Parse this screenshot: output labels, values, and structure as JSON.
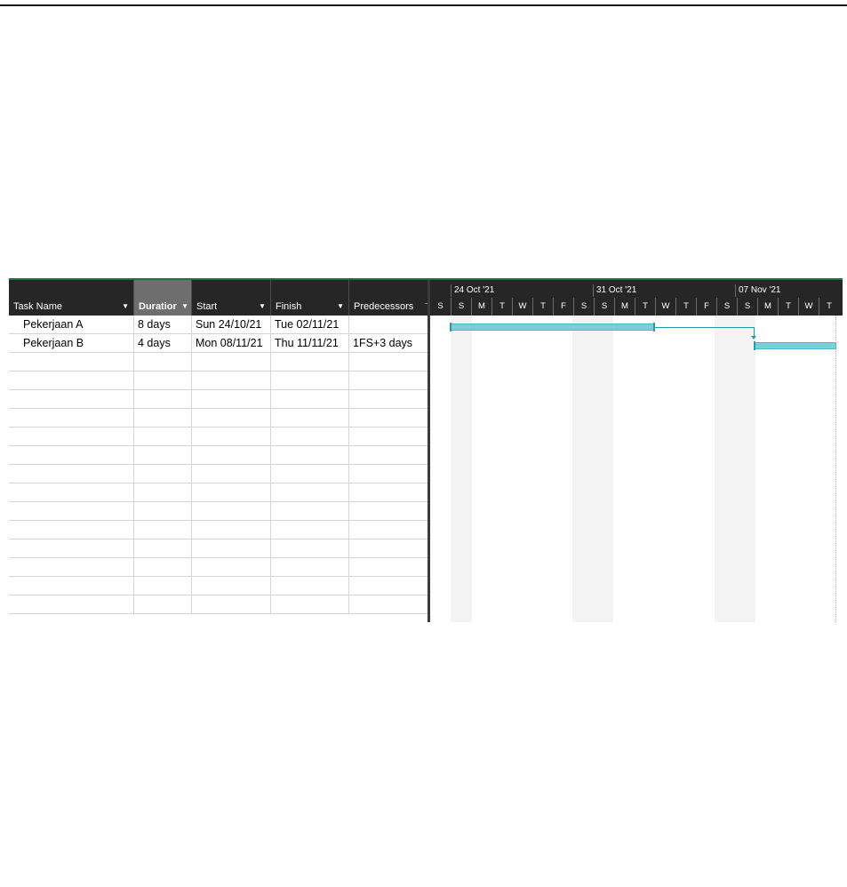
{
  "table": {
    "columns": [
      {
        "key": "name",
        "label": "Task Name",
        "dropdown": true,
        "active": false
      },
      {
        "key": "duration",
        "label": "Duratior",
        "dropdown": true,
        "active": true
      },
      {
        "key": "start",
        "label": "Start",
        "dropdown": true,
        "active": false
      },
      {
        "key": "finish",
        "label": "Finish",
        "dropdown": true,
        "active": false
      },
      {
        "key": "predecessors",
        "label": "Predecessors",
        "dropdown": false,
        "active": false
      }
    ],
    "rows": [
      {
        "name": "Pekerjaan A",
        "duration": "8 days",
        "start": "Sun 24/10/21",
        "finish": "Tue 02/11/21",
        "predecessors": ""
      },
      {
        "name": "Pekerjaan B",
        "duration": "4 days",
        "start": "Mon 08/11/21",
        "finish": "Thu 11/11/21",
        "predecessors": "1FS+3 days"
      }
    ],
    "empty_rows": 14
  },
  "timeline": {
    "weeks": [
      "24 Oct '21",
      "31 Oct '21",
      "07 Nov '21"
    ],
    "days": [
      "S",
      "S",
      "M",
      "T",
      "W",
      "T",
      "F",
      "S",
      "S",
      "M",
      "T",
      "W",
      "T",
      "F",
      "S",
      "S",
      "M",
      "T",
      "W",
      "T"
    ]
  },
  "colors": {
    "header_bg": "#262626",
    "active_header_bg": "#6e6e6e",
    "accent_green": "#217346",
    "task_bar": "#7ccfd8",
    "task_link": "#2e98a6"
  }
}
